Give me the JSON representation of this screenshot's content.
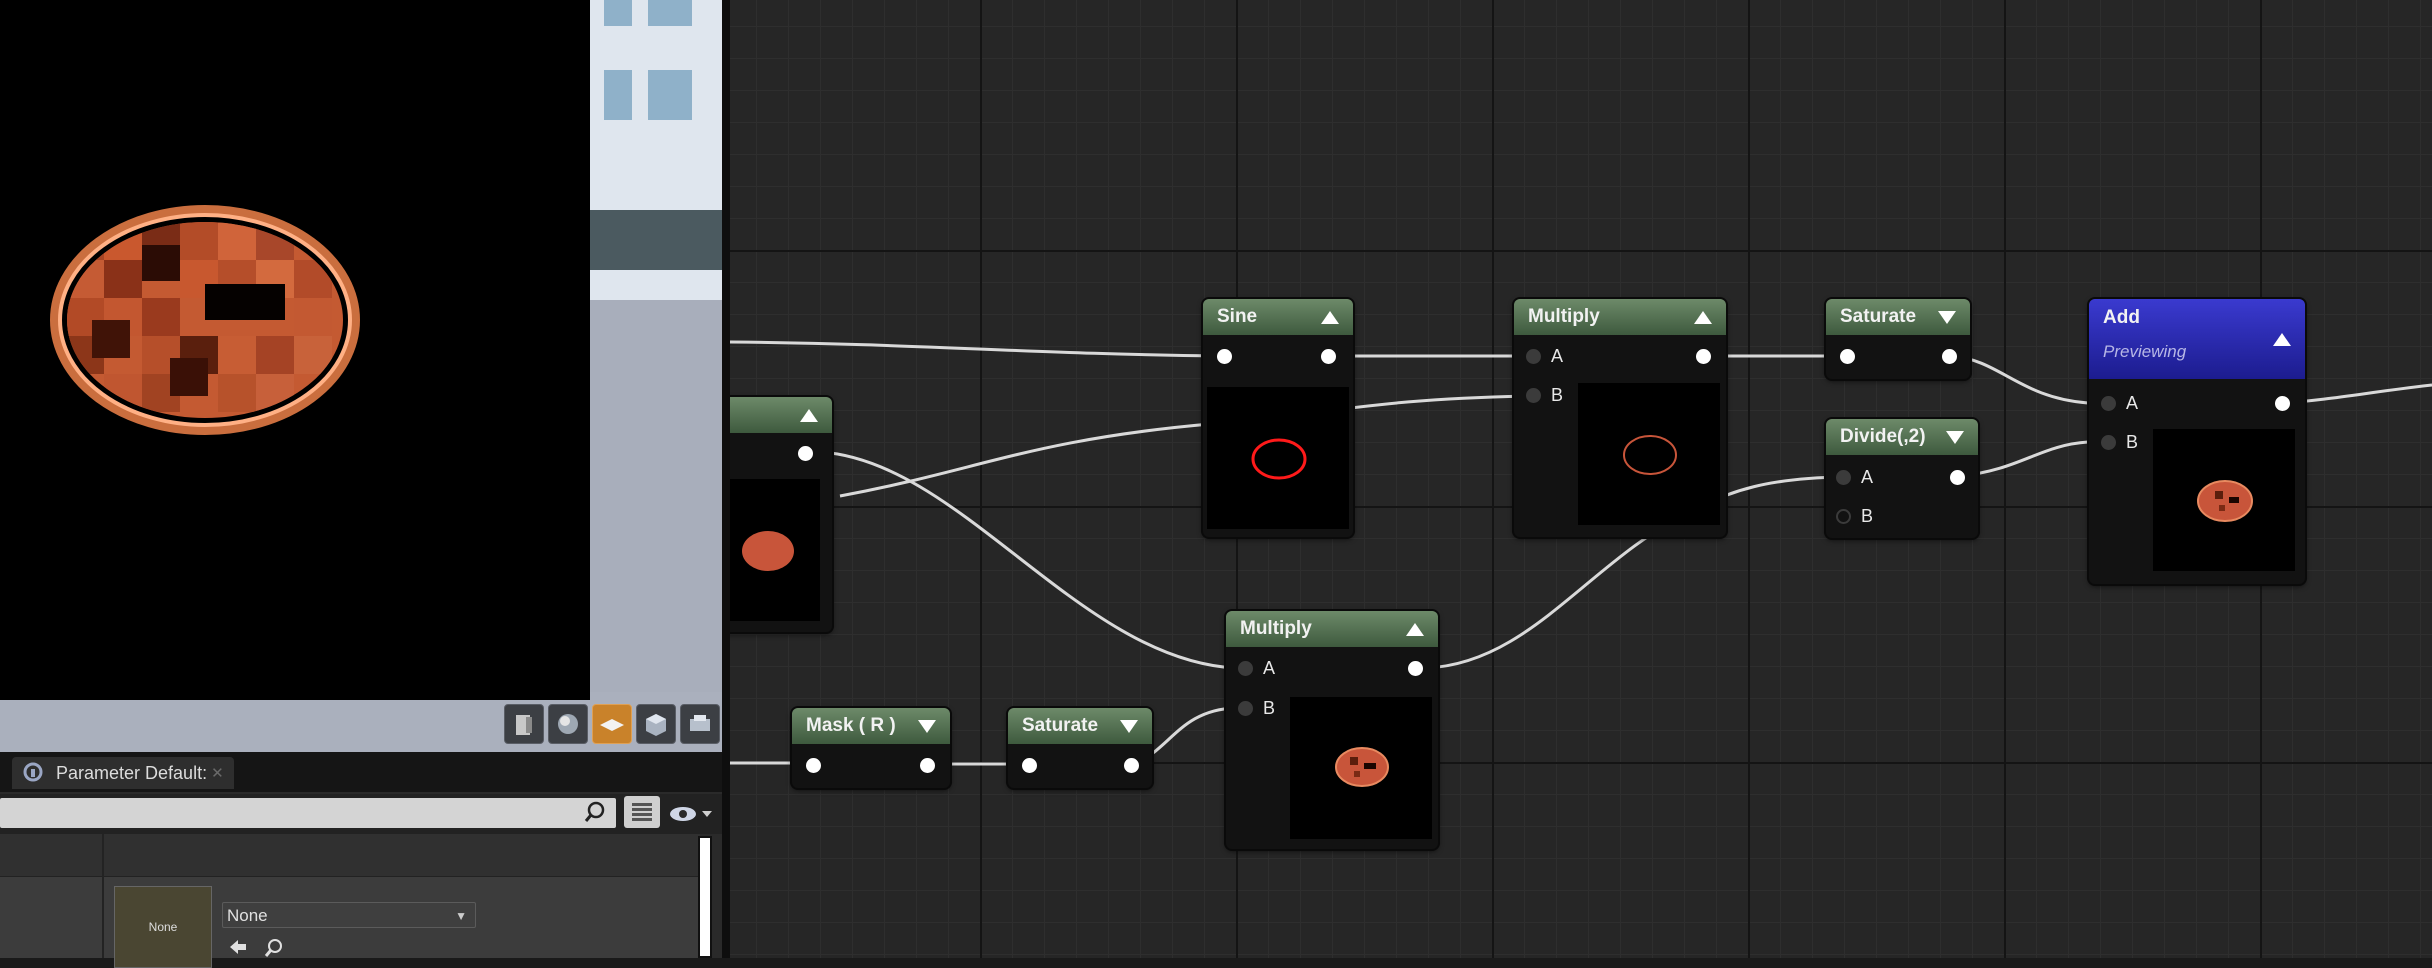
{
  "viewport": {
    "toolbar": [
      {
        "icon": "cylinder-icon",
        "active": false
      },
      {
        "icon": "sphere-icon",
        "active": false
      },
      {
        "icon": "plane-icon",
        "active": true
      },
      {
        "icon": "cube-icon",
        "active": false
      },
      {
        "icon": "custom-mesh-icon",
        "active": false
      }
    ]
  },
  "details_panel": {
    "tab_label": "Parameter Default:",
    "search_placeholder": "",
    "texture_thumb_label": "None",
    "texture_select_value": "None"
  },
  "graph": {
    "nodes": {
      "partial": {
        "title": ""
      },
      "sine": {
        "title": "Sine"
      },
      "multiply_top": {
        "title": "Multiply",
        "pin_a": "A",
        "pin_b": "B"
      },
      "saturate_top": {
        "title": "Saturate"
      },
      "divide": {
        "title": "Divide(,2)",
        "pin_a": "A",
        "pin_b": "B"
      },
      "add": {
        "title": "Add",
        "subtitle": "Previewing",
        "pin_a": "A",
        "pin_b": "B"
      },
      "mask": {
        "title": "Mask ( R )"
      },
      "saturate_bottom": {
        "title": "Saturate"
      },
      "multiply_bottom": {
        "title": "Multiply",
        "pin_a": "A",
        "pin_b": "B"
      }
    }
  },
  "colors": {
    "node_header_green": "#3e5a3e",
    "node_header_blue": "#1c1c8f",
    "toolbar_active": "#c9822a",
    "preview_red": "#ff1a1a",
    "preview_orange": "#c8553a"
  }
}
